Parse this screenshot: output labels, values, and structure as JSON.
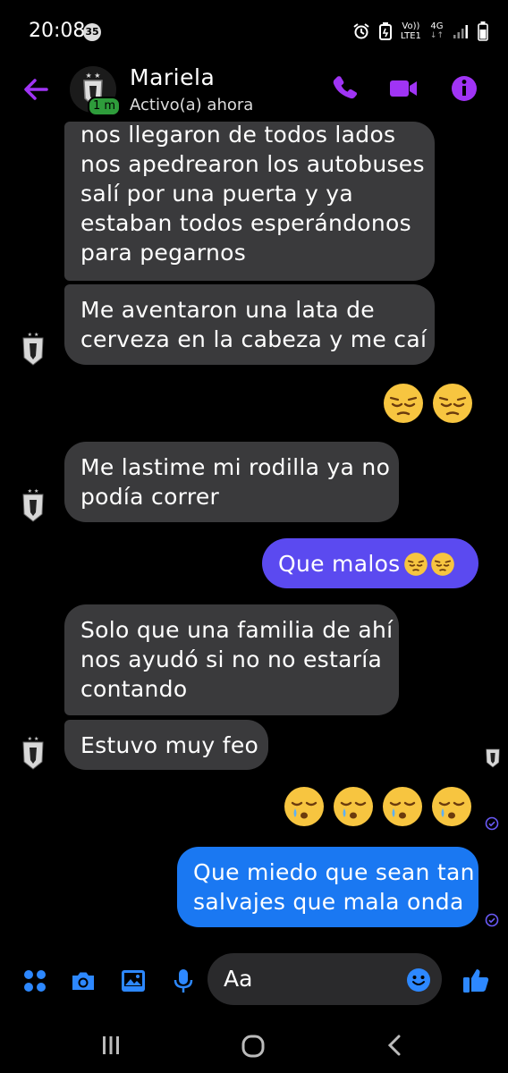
{
  "status_bar": {
    "time": "20:08",
    "notification_count": "35",
    "network_line1": "Vo))",
    "network_line2": "LTE1",
    "network_type": "4G"
  },
  "header": {
    "contact_name": "Mariela",
    "presence": "Activo(a) ahora",
    "active_badge": "1 m",
    "accent_color": "#a034f5"
  },
  "messages": [
    {
      "side": "in",
      "text_lines": [
        "nos llegaron de todos lados",
        "nos apedrearon los autobuses",
        "salí por una puerta y ya",
        "estaban todos esperándonos",
        "para pegarnos"
      ]
    },
    {
      "side": "in",
      "text_lines": [
        "Me aventaron una lata de",
        "cerveza en la cabeza y me caí"
      ]
    },
    {
      "side": "out",
      "emoji": [
        "pensive-face",
        "pensive-face"
      ]
    },
    {
      "side": "in",
      "text_lines": [
        "Me lastime mi rodilla ya no",
        "podía correr"
      ]
    },
    {
      "side": "out",
      "text": "Que malos",
      "emoji": [
        "pensive-face",
        "pensive-face"
      ]
    },
    {
      "side": "in",
      "text_lines": [
        "Solo que una familia de ahí",
        "nos ayudó si no no estaría",
        "contando"
      ]
    },
    {
      "side": "in",
      "text_lines": [
        "Estuvo muy feo"
      ]
    },
    {
      "side": "out",
      "emoji": [
        "sleepy-face",
        "sleepy-face",
        "sleepy-face",
        "sleepy-face"
      ]
    },
    {
      "side": "out",
      "text_lines": [
        "Que miedo que sean tan",
        "salvajes que mala onda"
      ]
    }
  ],
  "composer": {
    "placeholder": "Aa"
  },
  "colors": {
    "incoming_bubble": "#3a3a3c",
    "outgoing_purple": "#5b4af0",
    "outgoing_blue": "#1a78f2",
    "icon_blue": "#2d88ff"
  }
}
